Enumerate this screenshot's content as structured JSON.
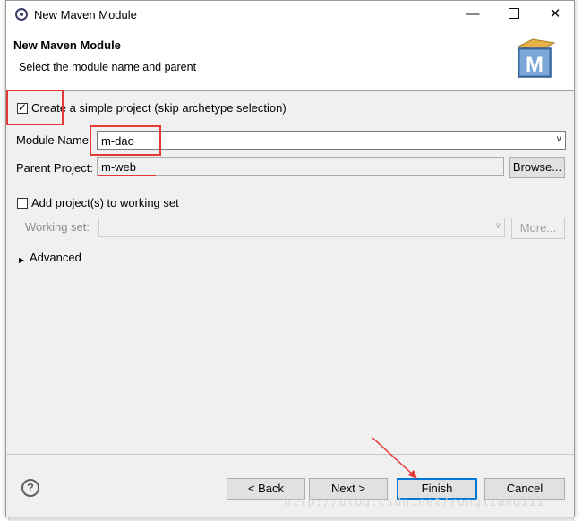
{
  "window": {
    "title": "New Maven Module"
  },
  "banner": {
    "title": "New Maven Module",
    "subtitle": "Select the module name and parent",
    "logo_letter": "M"
  },
  "options": {
    "simple_project_label": "Create a simple project (skip archetype selection)",
    "simple_project_checked": true
  },
  "module": {
    "name_label": "Module Name:",
    "name_value": "m-dao"
  },
  "parent": {
    "label": "Parent Project:",
    "value": "m-web",
    "browse_label": "Browse..."
  },
  "working_set": {
    "add_label": "Add project(s) to working set",
    "checked": false,
    "set_label": "Working set:",
    "more_label": "More..."
  },
  "advanced": {
    "label": "Advanced"
  },
  "buttons": {
    "help": "?",
    "back": "< Back",
    "next": "Next >",
    "finish": "Finish",
    "cancel": "Cancel"
  },
  "watermark": "http://blog.csdn.net/rongxiang111",
  "colors": {
    "annotation_red": "#e53935",
    "default_button_border": "#0078d7"
  },
  "icons": {
    "app": "eclipse-icon",
    "logo": "maven-logo-icon",
    "help": "help-icon"
  }
}
